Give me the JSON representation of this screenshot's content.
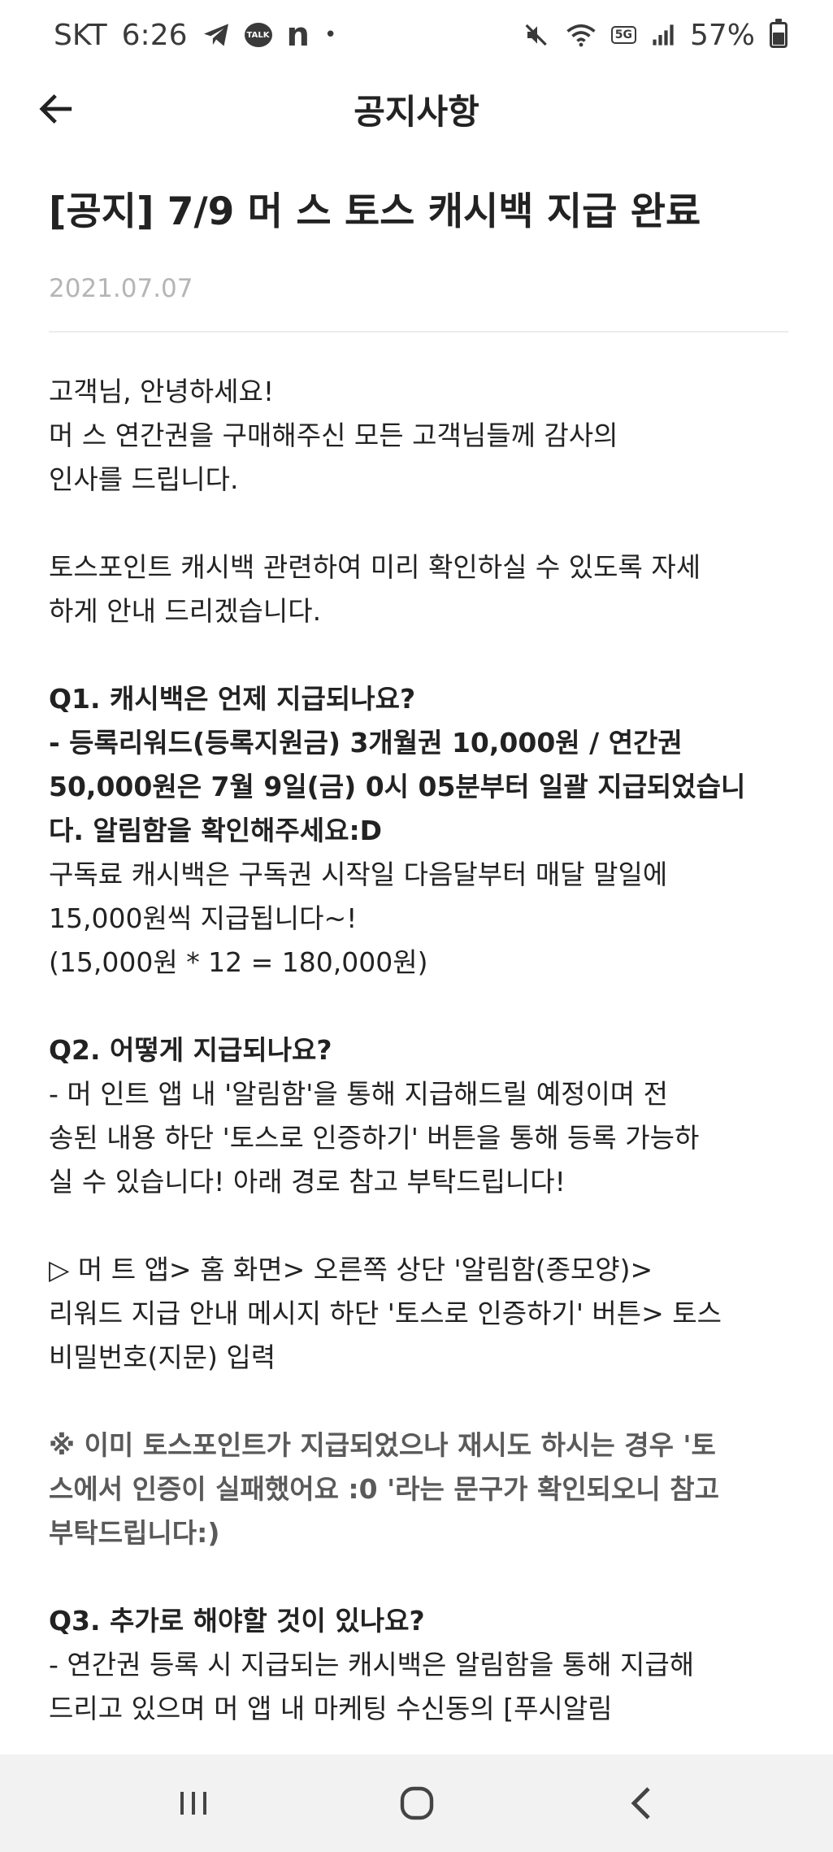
{
  "status": {
    "carrier": "SKT",
    "time": "6:26",
    "talk_label": "TALK",
    "n_label": "n",
    "dot": "•",
    "gen_label": "5G",
    "battery": "57%",
    "battery_level": 0.57
  },
  "header": {
    "title": "공지사항"
  },
  "notice": {
    "title": "[공지] 7/9 머         스 토스 캐시백 지급 완료",
    "date": "2021.07.07"
  },
  "body": {
    "greeting": "고객님, 안녕하세요!",
    "p1_line1": "머     스 연간권을 구매해주신 모든 고객님들께 감사의",
    "p1_line2": "인사를 드립니다.",
    "p2_line1": "토스포인트 캐시백 관련하여 미리 확인하실 수 있도록 자세",
    "p2_line2": "하게 안내 드리겠습니다.",
    "q1_title": "Q1. 캐시백은 언제 지급되나요?",
    "q1_bold1": "- 등록리워드(등록지원금) 3개월권 10,000원 / 연간권",
    "q1_bold2": "50,000원은 7월 9일(금) 0시 05분부터 일괄 지급되었습니",
    "q1_bold3": "다. 알림함을 확인해주세요:D",
    "q1_l1": "구독료 캐시백은 구독권 시작일 다음달부터 매달 말일에",
    "q1_l2": "15,000원씩 지급됩니다~!",
    "q1_l3": "(15,000원 * 12 = 180,000원)",
    "q2_title": "Q2. 어떻게 지급되나요?",
    "q2_l1": "- 머      인트 앱 내 '알림함'을 통해 지급해드릴 예정이며 전",
    "q2_l2": "송된 내용 하단 '토스로 인증하기' 버튼을 통해 등록 가능하",
    "q2_l3": "실 수 있습니다! 아래 경로 참고 부탁드립니다!",
    "path_l1": "▷ 머        트 앱> 홈 화면> 오른쪽 상단 '알림함(종모양)>",
    "path_l2": "리워드 지급 안내 메시지 하단 '토스로 인증하기' 버튼> 토스",
    "path_l3": "비밀번호(지문) 입력",
    "note_l1": "※ 이미 토스포인트가 지급되었으나 재시도 하시는 경우 '토",
    "note_l2": "스에서 인증이 실패했어요 :0 '라는 문구가 확인되오니 참고",
    "note_l3": "부탁드립니다:)",
    "q3_title": "Q3. 추가로 해야할 것이 있나요?",
    "q3_l1": "- 연간권 등록 시 지급되는 캐시백은 알림함을 통해 지급해",
    "q3_l2": "드리고 있으며 머        앱 내 마케팅 수신동의 [푸시알림"
  }
}
